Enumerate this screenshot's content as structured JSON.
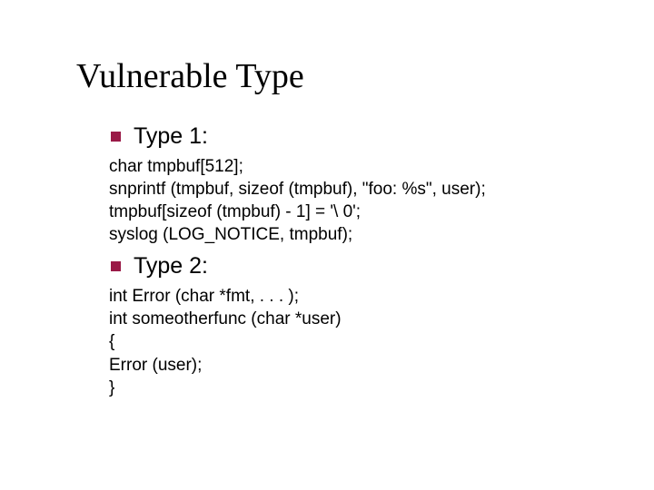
{
  "title": "Vulnerable Type",
  "sections": [
    {
      "heading": "Type 1:",
      "code": "char tmpbuf[512];\nsnprintf (tmpbuf, sizeof (tmpbuf), \"foo: %s\", user);\ntmpbuf[sizeof (tmpbuf) - 1] = '\\ 0';\nsyslog (LOG_NOTICE, tmpbuf);"
    },
    {
      "heading": "Type 2:",
      "code": "int Error (char *fmt, . . . );\nint someotherfunc (char *user)\n{\nError (user);\n}"
    }
  ]
}
